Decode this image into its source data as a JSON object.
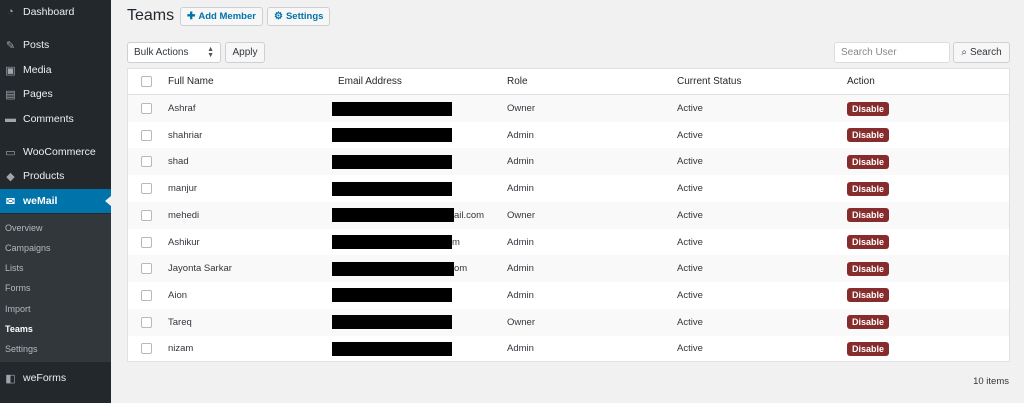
{
  "sidebar": {
    "items": [
      {
        "label": "Dashboard",
        "icon": "dashboard-icon",
        "glyph": "◔"
      },
      {
        "label": "Posts",
        "icon": "pin-icon",
        "glyph": "✎"
      },
      {
        "label": "Media",
        "icon": "media-icon",
        "glyph": "▣"
      },
      {
        "label": "Pages",
        "icon": "pages-icon",
        "glyph": "▤"
      },
      {
        "label": "Comments",
        "icon": "comment-icon",
        "glyph": "▬"
      },
      {
        "label": "WooCommerce",
        "icon": "woocommerce-icon",
        "glyph": "▭"
      },
      {
        "label": "Products",
        "icon": "products-icon",
        "glyph": "◆"
      },
      {
        "label": "weMail",
        "icon": "mail-icon",
        "glyph": "✉"
      },
      {
        "label": "weForms",
        "icon": "weforms-icon",
        "glyph": "◧"
      }
    ],
    "submenu": [
      "Overview",
      "Campaigns",
      "Lists",
      "Forms",
      "Import",
      "Teams",
      "Settings"
    ]
  },
  "header": {
    "title": "Teams",
    "add_member": "Add Member",
    "settings": "Settings"
  },
  "toolbar": {
    "bulk_actions": "Bulk Actions",
    "apply": "Apply",
    "search_placeholder": "Search User",
    "search_button": "Search"
  },
  "table": {
    "columns": [
      "Full Name",
      "Email Address",
      "Role",
      "Current Status",
      "Action"
    ],
    "rows": [
      {
        "name": "Ashraf",
        "email_visible": "",
        "role": "Owner",
        "status": "Active",
        "action": "Disable"
      },
      {
        "name": "shahriar",
        "email_visible": "",
        "role": "Admin",
        "status": "Active",
        "action": "Disable"
      },
      {
        "name": "shad",
        "email_visible": "",
        "role": "Admin",
        "status": "Active",
        "action": "Disable"
      },
      {
        "name": "manjur",
        "email_visible": "",
        "role": "Admin",
        "status": "Active",
        "action": "Disable"
      },
      {
        "name": "mehedi",
        "email_visible": "ail.com",
        "role": "Owner",
        "status": "Active",
        "action": "Disable"
      },
      {
        "name": "Ashikur",
        "email_visible": "m",
        "role": "Admin",
        "status": "Active",
        "action": "Disable"
      },
      {
        "name": "Jayonta Sarkar",
        "email_visible": "om",
        "role": "Admin",
        "status": "Active",
        "action": "Disable"
      },
      {
        "name": "Aion",
        "email_visible": "",
        "role": "Admin",
        "status": "Active",
        "action": "Disable"
      },
      {
        "name": "Tareq",
        "email_visible": "",
        "role": "Owner",
        "status": "Active",
        "action": "Disable"
      },
      {
        "name": "nizam",
        "email_visible": "",
        "role": "Admin",
        "status": "Active",
        "action": "Disable"
      }
    ]
  },
  "footer": {
    "items_count": "10 items"
  },
  "colors": {
    "accent": "#0073aa",
    "sidebar": "#23282d",
    "disable": "#862c2c"
  }
}
